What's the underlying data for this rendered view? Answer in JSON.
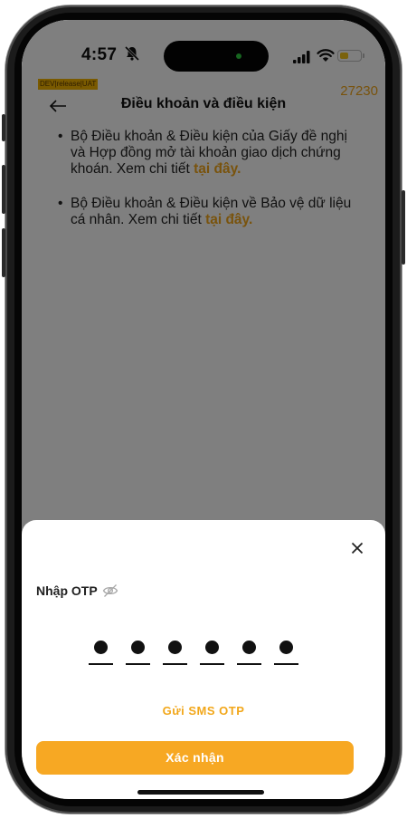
{
  "status_bar": {
    "time": "4:57",
    "icons": [
      "bell-muted-icon",
      "signal-icon",
      "wifi-icon",
      "battery-icon"
    ]
  },
  "header": {
    "env_badge": "DEV|release|UAT",
    "build_number": "27230",
    "title": "Điều khoản và điều kiện"
  },
  "content": {
    "items": [
      {
        "text": "Bộ Điều khoản & Điều kiện của Giấy đề nghị và Hợp đồng mở tài khoản giao dịch chứng khoán. Xem chi tiết ",
        "link": "tại đây."
      },
      {
        "text": "Bộ Điều khoản & Điều kiện về Bảo vệ dữ liệu cá nhân. Xem chi tiết ",
        "link": "tại đây."
      }
    ]
  },
  "otp_sheet": {
    "label": "Nhập OTP",
    "digits": 6,
    "resend": "Gửi SMS OTP",
    "confirm": "Xác nhận"
  },
  "colors": {
    "accent": "#f7a823",
    "link": "#f2a71a",
    "overlay": "rgba(0,0,0,0.5)"
  }
}
